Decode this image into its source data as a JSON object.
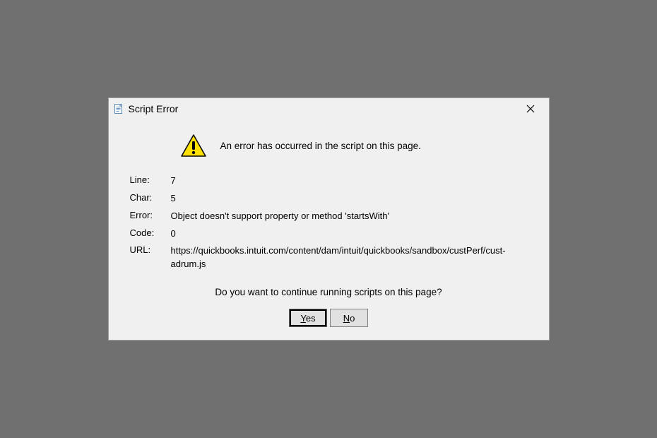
{
  "title": "Script Error",
  "header_message": "An error has occurred in the script on this page.",
  "details": {
    "line_label": "Line:",
    "line_value": "7",
    "char_label": "Char:",
    "char_value": "5",
    "error_label": "Error:",
    "error_value": "Object doesn't support property or method 'startsWith'",
    "code_label": "Code:",
    "code_value": "0",
    "url_label": "URL:",
    "url_value": "https://quickbooks.intuit.com/content/dam/intuit/quickbooks/sandbox/custPerf/cust-adrum.js"
  },
  "question": "Do you want to continue running scripts on this page?",
  "buttons": {
    "yes_mnemonic": "Y",
    "yes_rest": "es",
    "no_mnemonic": "N",
    "no_rest": "o"
  }
}
